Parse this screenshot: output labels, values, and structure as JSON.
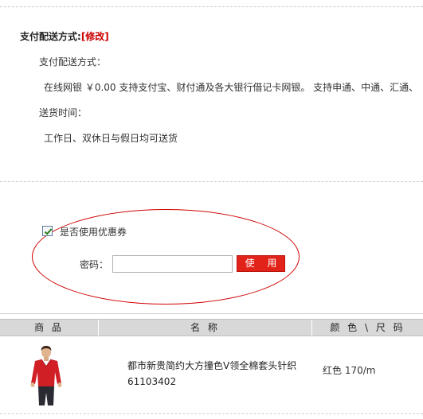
{
  "payment": {
    "section_title": "支付配送方式:",
    "edit_link": "[修改]",
    "method_label": "支付配送方式：",
    "method_value": "在线网银 ￥0.00 支持支付宝、财付通及各大银行借记卡网银。 支持申通、中通、汇通、",
    "delivery_time_label": "送货时间：",
    "delivery_time_value": "工作日、双休日与假日均可送货"
  },
  "coupon": {
    "checkbox_label": "是否使用优惠券",
    "checked": true,
    "password_label": "密码：",
    "password_value": "",
    "use_button": "使 用"
  },
  "table": {
    "headers": [
      "商 品",
      "名 称",
      "颜 色 \\ 尺 码"
    ],
    "rows": [
      {
        "name": "都市新贵简约大方撞色V领全棉套头针织61103402",
        "color_size": "红色 170/m"
      }
    ]
  },
  "colors": {
    "accent": "#e2231a",
    "annotation_ellipse": "#d00000",
    "header_bg": "#d8d8d8"
  }
}
